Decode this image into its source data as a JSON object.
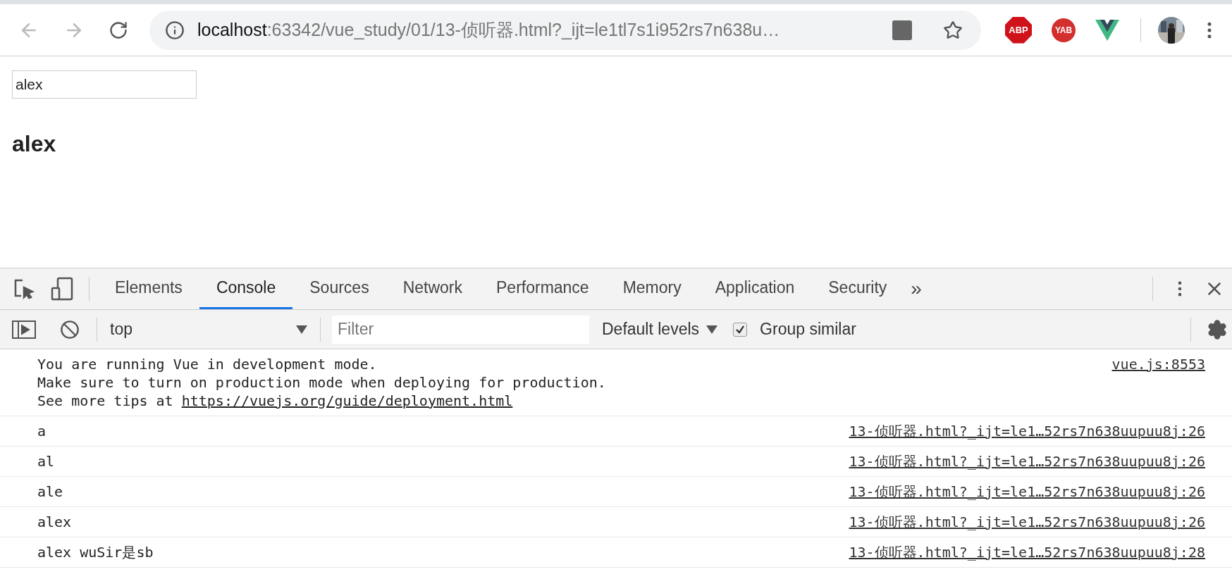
{
  "browser": {
    "url_host": "localhost",
    "url_rest": ":63342/vue_study/01/13-侦听器.html?_ijt=le1tl7s1i952rs7n638u…",
    "extensions": [
      {
        "kind": "octagon",
        "label": "ABP"
      },
      {
        "kind": "circle",
        "label": "YAB"
      },
      {
        "kind": "vue"
      }
    ]
  },
  "page": {
    "input_value": "alex",
    "heading": "alex"
  },
  "devtools": {
    "tabs": [
      {
        "label": "Elements",
        "selected": false
      },
      {
        "label": "Console",
        "selected": true
      },
      {
        "label": "Sources",
        "selected": false
      },
      {
        "label": "Network",
        "selected": false
      },
      {
        "label": "Performance",
        "selected": false
      },
      {
        "label": "Memory",
        "selected": false
      },
      {
        "label": "Application",
        "selected": false
      },
      {
        "label": "Security",
        "selected": false
      }
    ],
    "more": "»",
    "context": "top",
    "filter_placeholder": "Filter",
    "levels": "Default levels",
    "group_similar": {
      "label": "Group similar",
      "checked": true
    },
    "messages": [
      {
        "lines": [
          {
            "text": "You are running Vue in development mode."
          },
          {
            "text": "Make sure to turn on production mode when deploying for production."
          },
          {
            "text": "See more tips at ",
            "link": "https://vuejs.org/guide/deployment.html"
          }
        ],
        "source": "vue.js:8553"
      },
      {
        "lines": [
          {
            "text": "a"
          }
        ],
        "source": "13-侦听器.html?_ijt=le1…52rs7n638uupuu8j:26"
      },
      {
        "lines": [
          {
            "text": "al"
          }
        ],
        "source": "13-侦听器.html?_ijt=le1…52rs7n638uupuu8j:26"
      },
      {
        "lines": [
          {
            "text": "ale"
          }
        ],
        "source": "13-侦听器.html?_ijt=le1…52rs7n638uupuu8j:26"
      },
      {
        "lines": [
          {
            "text": "alex"
          }
        ],
        "source": "13-侦听器.html?_ijt=le1…52rs7n638uupuu8j:26"
      },
      {
        "lines": [
          {
            "text": "alex wuSir是sb"
          }
        ],
        "source": "13-侦听器.html?_ijt=le1…52rs7n638uupuu8j:28"
      }
    ]
  }
}
